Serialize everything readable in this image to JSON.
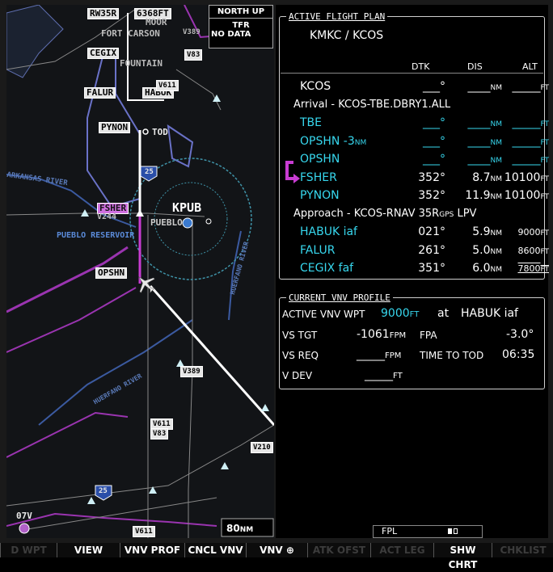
{
  "map": {
    "orientation": "NORTH UP",
    "tfr_title": "TFR",
    "tfr_status": "NO DATA",
    "range": "80",
    "range_unit": "NM",
    "labels": {
      "rw35r": "RW35R",
      "alt_tag": "6368FT",
      "moor": "MOOR",
      "fort_carson": "FORT CARSON",
      "v389_top": "V389",
      "cegix": "CEGIX",
      "fountain": "FOUNTAIN",
      "v83_top": "V83",
      "falur": "FALUR",
      "habuk": "HABUK",
      "v611_top": "V611",
      "pynon": "PYNON",
      "tod": "TOD",
      "v25_shield": "25",
      "fsher": "FSHER",
      "v244": "V244",
      "kpub": "KPUB",
      "pueblo": "PUEBLO",
      "pueblo_reservoir": "PUEBLO RESERVOIR",
      "opshn": "OPSHN",
      "arkansas_river": "ARKANSAS RIVER",
      "huerfano_river_1": "HUERFANO RIVER",
      "v389_mid": "V389",
      "huerfano_river_2": "HUERFANO RIVER",
      "v611_v83": "V611",
      "v83_low": "V83",
      "v210": "V210",
      "v25_shield_low": "25",
      "v611_bottom": "V611",
      "v07": "07V"
    }
  },
  "fpl": {
    "title": "ACTIVE FLIGHT PLAN",
    "route": "KMKC / KCOS",
    "headers": {
      "dtk": "DTK",
      "dis": "DIS",
      "alt": "ALT"
    },
    "rows": [
      {
        "type": "wp",
        "name": "KCOS",
        "dtk": "___°",
        "dis": "____",
        "dis_u": "NM",
        "alt": "_____",
        "alt_u": "FT",
        "color": "white"
      },
      {
        "type": "section",
        "text": "Arrival - KCOS-TBE.DBRY1.ALL"
      },
      {
        "type": "wp",
        "name": "TBE",
        "dtk": "___°",
        "dis": "____",
        "dis_u": "NM",
        "alt": "_____",
        "alt_u": "FT",
        "color": "cyan"
      },
      {
        "type": "wp",
        "name": "OPSHN -3",
        "name_u": "NM",
        "dtk": "___°",
        "dis": "____",
        "dis_u": "NM",
        "alt": "_____",
        "alt_u": "FT",
        "color": "cyan"
      },
      {
        "type": "wp",
        "name": "OPSHN",
        "dtk": "___°",
        "dis": "____",
        "dis_u": "NM",
        "alt": "_____",
        "alt_u": "FT",
        "color": "cyan"
      },
      {
        "type": "wp",
        "name": "FSHER",
        "dtk": "352°",
        "dis": "8.7",
        "dis_u": "NM",
        "alt": "10100",
        "alt_u": "FT",
        "color": "cyan",
        "active": true
      },
      {
        "type": "wp",
        "name": "PYNON",
        "dtk": "352°",
        "dis": "11.9",
        "dis_u": "NM",
        "alt": "10100",
        "alt_u": "FT",
        "color": "cyan"
      },
      {
        "type": "section",
        "text": "Approach - KCOS-RNAV 35R",
        "text_gps": "GPS",
        "text_end": " LPV"
      },
      {
        "type": "wp",
        "name": "HABUK iaf",
        "dtk": "021°",
        "dis": "5.9",
        "dis_u": "NM",
        "alt": "9000",
        "alt_u": "FT",
        "color": "cyan",
        "alt_small": true
      },
      {
        "type": "wp",
        "name": "FALUR",
        "dtk": "261°",
        "dis": "5.0",
        "dis_u": "NM",
        "alt": "8600",
        "alt_u": "FT",
        "color": "cyan",
        "alt_small": true
      },
      {
        "type": "wp",
        "name": "CEGIX faf",
        "dtk": "351°",
        "dis": "6.0",
        "dis_u": "NM",
        "alt": "7800",
        "alt_u": "FT",
        "color": "cyan",
        "alt_small": true,
        "alt_under": true
      }
    ]
  },
  "vnv": {
    "title": "CURRENT VNV PROFILE",
    "active_label": "ACTIVE VNV WPT",
    "active_alt": "9000",
    "active_alt_u": "FT",
    "at": "at",
    "active_wpt": "HABUK iaf",
    "vs_tgt_label": "VS TGT",
    "vs_tgt": "-1061",
    "vs_tgt_u": "FPM",
    "fpa_label": "FPA",
    "fpa": "-3.0°",
    "vs_req_label": "VS REQ",
    "vs_req": "_____",
    "vs_req_u": "FPM",
    "tod_label": "TIME TO TOD",
    "tod": "06:35",
    "vdev_label": "V DEV",
    "vdev": "_____",
    "vdev_u": "FT"
  },
  "fpl_bar": {
    "label": "FPL"
  },
  "softkeys": [
    {
      "label": "D WPT",
      "enabled": false
    },
    {
      "label": "VIEW",
      "enabled": true
    },
    {
      "label": "VNV PROF",
      "enabled": true
    },
    {
      "label": "CNCL VNV",
      "enabled": true
    },
    {
      "label": "VNV ⊕",
      "enabled": true
    },
    {
      "label": "ATK OFST",
      "enabled": false
    },
    {
      "label": "ACT LEG",
      "enabled": false
    },
    {
      "label": "SHW CHRT",
      "enabled": true
    },
    {
      "label": "CHKLIST",
      "enabled": false
    }
  ],
  "colors": {
    "cyan": "#37d7ee",
    "magenta": "#c83cd2",
    "white": "#ffffff"
  }
}
